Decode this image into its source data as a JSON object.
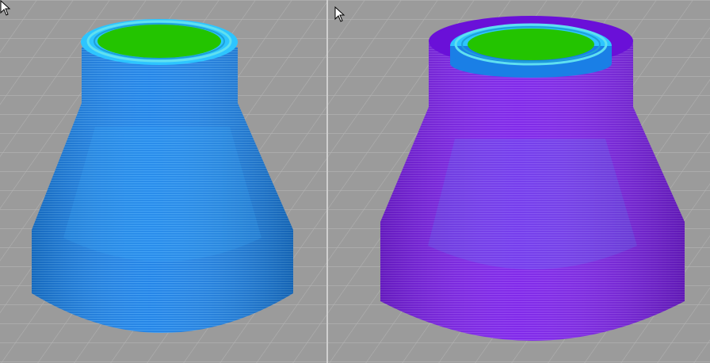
{
  "scene": {
    "background_color": "#9b9b9b",
    "grid_color": "#b4b4b4",
    "grid_dark_color": "#7e7e7e"
  },
  "viewports": [
    {
      "id": "left",
      "icon": "layer-preview-icon",
      "shell_color": "#1a7fe6",
      "shell_light": "#3a9af2",
      "inner_color": "#2ec5ff",
      "rim_color": "#5fe0f0",
      "top_fill_color": "#23c400"
    },
    {
      "id": "right",
      "icon": "layer-preview-icon",
      "shell_color": "#7a1fe8",
      "shell_light": "#8e3df0",
      "inner_color": "#2ec5ff",
      "rim_color": "#5fe0f0",
      "top_fill_color": "#23c400"
    }
  ],
  "cursors": [
    "mouse-pointer-icon",
    "mouse-pointer-icon"
  ]
}
